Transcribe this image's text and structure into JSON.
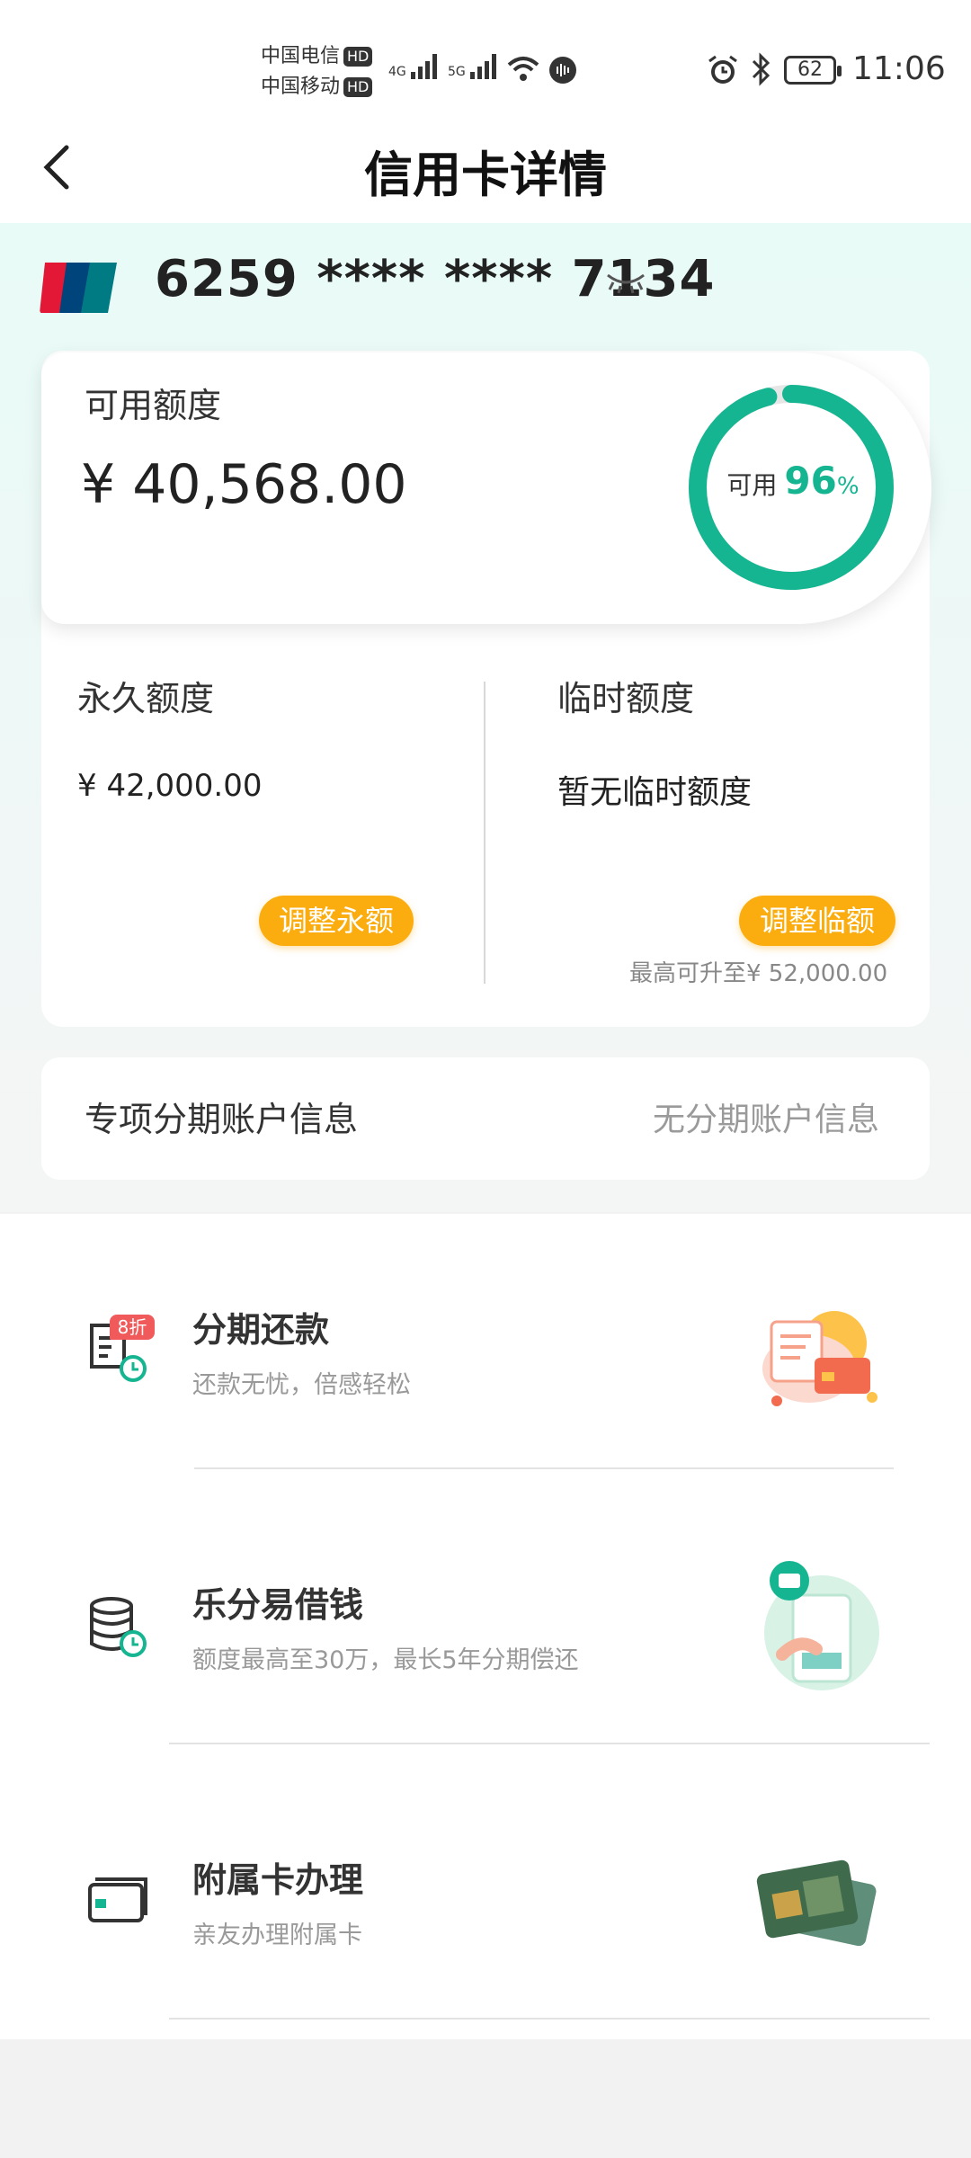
{
  "status_bar": {
    "carrier1": "中国电信",
    "carrier2": "中国移动",
    "hd": "HD",
    "net1": "4G",
    "net2": "5G",
    "battery": "62",
    "time": "11:06"
  },
  "header": {
    "title": "信用卡详情"
  },
  "card": {
    "number": "6259 **** **** 7134"
  },
  "available": {
    "label": "可用额度",
    "amount": "¥ 40,568.00",
    "ring_label": "可用",
    "percent_value": "96",
    "percent_unit": "%",
    "percent_fraction": 0.96
  },
  "permanent": {
    "label": "永久额度",
    "amount": "¥ 42,000.00",
    "button": "调整永额"
  },
  "temporary": {
    "label": "临时额度",
    "amount": "暂无临时额度",
    "button": "调整临额",
    "max_note": "最高可升至¥ 52,000.00"
  },
  "installment_account": {
    "label": "专项分期账户信息",
    "value": "无分期账户信息"
  },
  "services": [
    {
      "title": "分期还款",
      "desc": "还款无忧，倍感轻松",
      "badge": "8折",
      "icon": "bill-clock-icon"
    },
    {
      "title": "乐分易借钱",
      "desc": "额度最高至30万，最长5年分期偿还",
      "icon": "coins-clock-icon"
    },
    {
      "title": "附属卡办理",
      "desc": "亲友办理附属卡",
      "icon": "card-icon"
    }
  ],
  "colors": {
    "accent": "#16b592",
    "button": "#fbad10"
  }
}
